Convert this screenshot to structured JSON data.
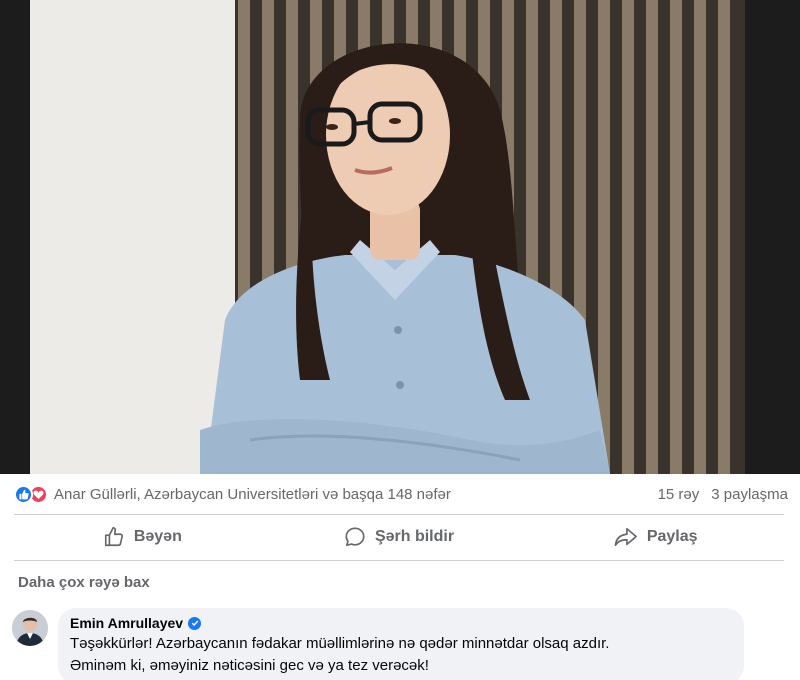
{
  "post": {
    "photo_alt": "photo",
    "reactions": {
      "icons": [
        "like-reaction-icon",
        "love-reaction-icon"
      ],
      "summary": "Anar Güllərli, Azərbaycan Universitetləri və başqa 148 nəfər",
      "comments_count": "15 rəy",
      "shares_count": "3 paylaşma"
    },
    "actions": {
      "like_label": "Bəyən",
      "comment_label": "Şərh bildir",
      "share_label": "Paylaş"
    }
  },
  "comments": {
    "more_label": "Daha çox rəyə bax",
    "items": [
      {
        "author": "Emin Amrullayev",
        "verified": true,
        "line1": "Təşəkkürlər! Azərbaycanın fədakar müəllimlərinə nə qədər minnətdar olsaq azdır.",
        "line2": "Əminəm ki, əməyiniz nəticəsini gec və ya tez verəcək!"
      }
    ]
  },
  "colors": {
    "like_blue": "#1877f2",
    "love_red": "#f33e58",
    "secondary_text": "#65676b",
    "bubble_bg": "#f0f2f5"
  }
}
